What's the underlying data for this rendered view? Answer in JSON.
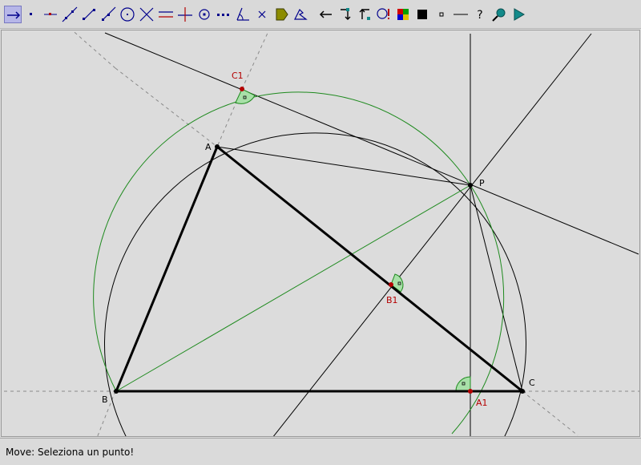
{
  "toolbar": {
    "tools": [
      {
        "icon": "move-arrow-icon",
        "selected": true
      },
      {
        "icon": "point-icon"
      },
      {
        "icon": "point-on-object-icon"
      },
      {
        "icon": "line-icon"
      },
      {
        "icon": "segment-icon"
      },
      {
        "icon": "ray-icon"
      },
      {
        "icon": "circle-icon"
      },
      {
        "icon": "intersection-icon"
      },
      {
        "icon": "parallel-line-icon"
      },
      {
        "icon": "perpendicular-line-icon"
      },
      {
        "icon": "midpoint-icon"
      },
      {
        "icon": "dotted-line-icon"
      },
      {
        "icon": "angle-icon"
      },
      {
        "icon": "delete-cross-icon"
      },
      {
        "icon": "label-tag-icon"
      },
      {
        "icon": "measure-icon"
      },
      {
        "icon": "undo-arrow-icon"
      },
      {
        "icon": "redo-step-icon"
      },
      {
        "icon": "replay-step-icon"
      },
      {
        "icon": "macro-icon"
      },
      {
        "icon": "color-palette-icon"
      },
      {
        "icon": "fill-square-icon"
      },
      {
        "icon": "small-square-icon"
      },
      {
        "icon": "line-style-icon"
      },
      {
        "icon": "help-icon"
      },
      {
        "icon": "zoom-pan-icon"
      },
      {
        "icon": "play-triangle-icon"
      }
    ],
    "help_glyph": "?"
  },
  "points": {
    "A": "A",
    "B": "B",
    "C": "C",
    "P": "P",
    "A1": "A1",
    "B1": "B1",
    "C1": "C1"
  },
  "colors": {
    "triangle": "#000000",
    "green": "#1e8a1e",
    "foot_points": "#b40000",
    "angle_fill": "#a8e0a8",
    "dashed": "#8a8a8a"
  },
  "status": {
    "text": "Move: Seleziona un punto!"
  }
}
